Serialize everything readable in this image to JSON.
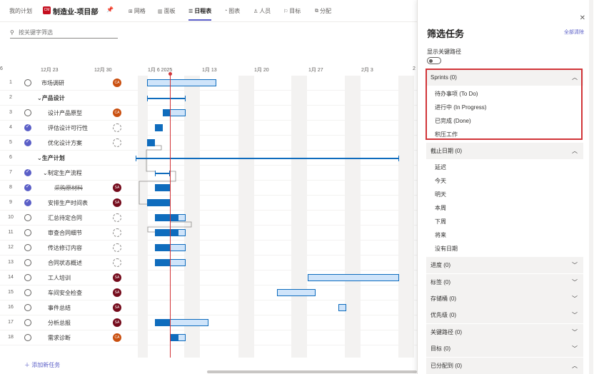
{
  "topbar": {
    "plans_link": "我的计划",
    "plan_badge": "CM",
    "plan_name": "制造业-项目部",
    "tabs": [
      {
        "icon": "grid-icon",
        "label": "网格"
      },
      {
        "icon": "board-icon",
        "label": "面板"
      },
      {
        "icon": "timeline-icon",
        "label": "日程表"
      },
      {
        "icon": "chart-icon",
        "label": "图表"
      },
      {
        "icon": "people-icon",
        "label": "人员"
      },
      {
        "icon": "goal-icon",
        "label": "目标"
      },
      {
        "icon": "share-icon",
        "label": "分配"
      }
    ]
  },
  "search": {
    "placeholder": "按关键字筛选"
  },
  "timeline": {
    "ticks": [
      "6",
      "12月 23",
      "12月 30",
      "1月 6 2025",
      "1月 13",
      "1月 20",
      "1月 27",
      "2月 3",
      "2"
    ]
  },
  "tasks": [
    {
      "num": "1",
      "name": "市场调研",
      "done": false,
      "avatar": "CA",
      "indent": 0,
      "group": false,
      "strike": false
    },
    {
      "num": "2",
      "name": "产品设计",
      "done": false,
      "avatar": "",
      "indent": 0,
      "group": true,
      "strike": false
    },
    {
      "num": "3",
      "name": "设计产品原型",
      "done": false,
      "avatar": "CA",
      "indent": 1,
      "group": false,
      "strike": false
    },
    {
      "num": "4",
      "name": "评估设计可行性",
      "done": true,
      "avatar": "blank",
      "indent": 1,
      "group": false,
      "strike": false
    },
    {
      "num": "5",
      "name": "优化设计方案",
      "done": true,
      "avatar": "blank",
      "indent": 1,
      "group": false,
      "strike": false
    },
    {
      "num": "6",
      "name": "生产计划",
      "done": false,
      "avatar": "",
      "indent": 0,
      "group": true,
      "strike": false
    },
    {
      "num": "7",
      "name": "制定生产流程",
      "done": true,
      "avatar": "",
      "indent": 1,
      "group": true,
      "strike": false
    },
    {
      "num": "8",
      "name": "采购原材料",
      "done": true,
      "avatar": "SA",
      "indent": 2,
      "group": false,
      "strike": true
    },
    {
      "num": "9",
      "name": "安排生产时间表",
      "done": true,
      "avatar": "SA",
      "indent": 1,
      "group": false,
      "strike": false
    },
    {
      "num": "10",
      "name": "汇总待定合同",
      "done": false,
      "avatar": "blank",
      "indent": 1,
      "group": false,
      "strike": false
    },
    {
      "num": "11",
      "name": "审查合同细节",
      "done": false,
      "avatar": "blank",
      "indent": 1,
      "group": false,
      "strike": false
    },
    {
      "num": "12",
      "name": "传达修订内容",
      "done": false,
      "avatar": "blank",
      "indent": 1,
      "group": false,
      "strike": false
    },
    {
      "num": "13",
      "name": "合同状态概述",
      "done": false,
      "avatar": "blank",
      "indent": 1,
      "group": false,
      "strike": false
    },
    {
      "num": "14",
      "name": "工人培训",
      "done": false,
      "avatar": "SA",
      "indent": 1,
      "group": false,
      "strike": false
    },
    {
      "num": "15",
      "name": "车间安全检查",
      "done": false,
      "avatar": "SA",
      "indent": 1,
      "group": false,
      "strike": false
    },
    {
      "num": "16",
      "name": "事件总结",
      "done": false,
      "avatar": "SA",
      "indent": 1,
      "group": false,
      "strike": false
    },
    {
      "num": "17",
      "name": "分析总报",
      "done": false,
      "avatar": "SA",
      "indent": 1,
      "group": false,
      "strike": false
    },
    {
      "num": "18",
      "name": "需求诊断",
      "done": false,
      "avatar": "CA",
      "indent": 1,
      "group": false,
      "strike": false
    }
  ],
  "add_task": "添加新任务",
  "panel": {
    "title": "筛选任务",
    "clear": "全部清除",
    "critical_path_label": "显示关键路径",
    "sections": [
      {
        "title": "Sprints (0)",
        "expanded": true,
        "options": [
          "待办事项 (To Do)",
          "进行中 (In Progress)",
          "已完成 (Done)",
          "积压工作"
        ]
      },
      {
        "title": "截止日期 (0)",
        "expanded": true,
        "options": [
          "延迟",
          "今天",
          "明天",
          "本周",
          "下周",
          "将来",
          "没有日期"
        ]
      },
      {
        "title": "进度 (0)",
        "expanded": false,
        "options": []
      },
      {
        "title": "标签 (0)",
        "expanded": false,
        "options": []
      },
      {
        "title": "存储桶 (0)",
        "expanded": false,
        "options": []
      },
      {
        "title": "优先级 (0)",
        "expanded": false,
        "options": []
      },
      {
        "title": "关键路径 (0)",
        "expanded": false,
        "options": []
      },
      {
        "title": "目标 (0)",
        "expanded": false,
        "options": []
      },
      {
        "title": "已分配到 (0)",
        "expanded": true,
        "options": []
      }
    ]
  }
}
